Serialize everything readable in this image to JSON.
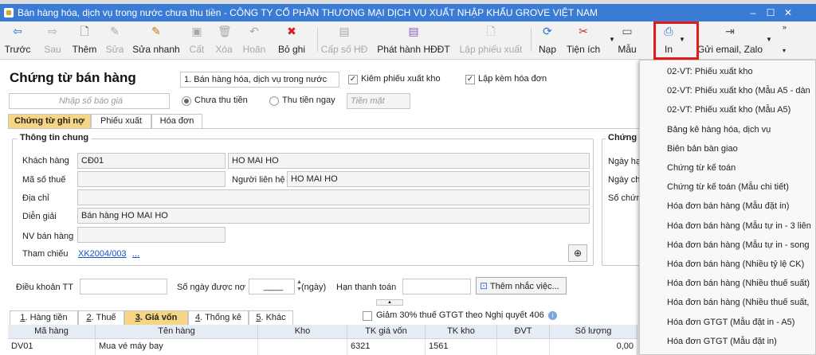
{
  "window": {
    "title": "Bán hàng hóa, dịch vụ trong nước chưa thu tiền - CÔNG TY CỔ PHẦN THƯƠNG MẠI DỊCH VỤ XUẤT NHẬP KHẨU GROVE VIỆT NAM",
    "minimize": "–",
    "maximize": "☐",
    "close": "✕"
  },
  "toolbar": [
    {
      "label": "Trước",
      "icon": "arrow-left-icon",
      "glyph": "⇦",
      "enabled": true,
      "color": "#2b6fd6"
    },
    {
      "label": "Sau",
      "icon": "arrow-right-icon",
      "glyph": "⇨",
      "enabled": false,
      "color": "#a8a8a8"
    },
    {
      "label": "Thêm",
      "icon": "add-document-icon",
      "glyph": "🗋",
      "enabled": true,
      "color": "#555"
    },
    {
      "label": "Sửa",
      "icon": "edit-icon",
      "glyph": "✎",
      "enabled": false,
      "color": "#a8a8a8"
    },
    {
      "label": "Sửa nhanh",
      "icon": "quick-edit-icon",
      "glyph": "✎",
      "enabled": true,
      "color": "#c07a10"
    },
    {
      "label": "Cất",
      "icon": "save-icon",
      "glyph": "▣",
      "enabled": false,
      "color": "#a8a8a8"
    },
    {
      "label": "Xóa",
      "icon": "delete-icon",
      "glyph": "🗑",
      "enabled": false,
      "color": "#a8a8a8"
    },
    {
      "label": "Hoãn",
      "icon": "undo-icon",
      "glyph": "↶",
      "enabled": false,
      "color": "#a8a8a8"
    },
    {
      "label": "Bỏ ghi",
      "icon": "unpost-icon",
      "glyph": "✖",
      "enabled": true,
      "color": "#d62020"
    },
    {
      "label": "Cấp số HĐ",
      "icon": "invoice-number-icon",
      "glyph": "▤",
      "enabled": false,
      "color": "#a8a8a8"
    },
    {
      "label": "Phát hành HĐĐT",
      "icon": "issue-einvoice-icon",
      "glyph": "▤",
      "enabled": true,
      "color": "#8a5cc8"
    },
    {
      "label": "Lập phiếu xuất",
      "icon": "create-slip-icon",
      "glyph": "🗋",
      "enabled": false,
      "color": "#a8a8a8"
    },
    {
      "label": "Nạp",
      "icon": "refresh-icon",
      "glyph": "⟳",
      "enabled": true,
      "color": "#2b6fd6"
    },
    {
      "label": "Tiện ích",
      "icon": "tools-icon",
      "glyph": "✂",
      "enabled": true,
      "color": "#c03030"
    },
    {
      "label": "Mẫu",
      "icon": "template-icon",
      "glyph": "▭",
      "enabled": true,
      "color": "#555"
    },
    {
      "label": "In",
      "icon": "printer-icon",
      "glyph": "⎙",
      "enabled": true,
      "color": "#2b6fd6"
    },
    {
      "label": "Gửi email, Zalo",
      "icon": "send-icon",
      "glyph": "⇥",
      "enabled": true,
      "color": "#555"
    }
  ],
  "form": {
    "heading": "Chứng từ bán hàng",
    "sale_type": "1. Bán hàng hóa, dịch vụ trong nước",
    "chk_export": "Kiêm phiếu xuất kho",
    "chk_invoice": "Lập kèm hóa đơn",
    "quote_placeholder": "Nhập số báo giá",
    "radio_unpaid": "Chưa thu tiền",
    "radio_paid": "Thu tiền ngay",
    "pay_method": "Tiền mặt",
    "tabs": [
      "Chứng từ ghi nợ",
      "Phiếu xuất",
      "Hóa đơn"
    ],
    "general_title": "Thông tin chung",
    "doc_title": "Chứng t",
    "lbl_customer": "Khách hàng",
    "customer_code": "CĐ01",
    "customer_name": "HO MAI HO",
    "lbl_tax": "Mã số thuế",
    "lbl_contact": "Người liên hệ",
    "contact": "HO MAI HO",
    "lbl_address": "Địa chỉ",
    "lbl_desc": "Diễn giải",
    "desc": "Bán hàng HO MAI HO",
    "lbl_staff": "NV bán hàng",
    "lbl_ref": "Tham chiếu",
    "ref": "XK2004/003",
    "ref_more": "...",
    "doc_labels": [
      "Ngày hạ",
      "Ngày ch",
      "Số chứn"
    ],
    "lbl_terms": "Điều khoản TT",
    "lbl_days": "Số ngày được nợ",
    "days_value": "____",
    "days_unit": "(ngày)",
    "lbl_due": "Hạn thanh toán",
    "reminder_btn": "Thêm nhắc việc...",
    "vat_reduce": "Giảm 30% thuế GTGT theo Nghị quyết 406"
  },
  "detail_tabs": [
    {
      "key": "1",
      "rest": ". Hàng tiền",
      "active": false
    },
    {
      "key": "2",
      "rest": ". Thuế",
      "active": false
    },
    {
      "key": "3",
      "rest": ". Giá vốn",
      "active": true
    },
    {
      "key": "4",
      "rest": ". Thống kê",
      "active": false
    },
    {
      "key": "5",
      "rest": ". Khác",
      "active": false
    }
  ],
  "grid": {
    "headers": [
      "Mã hàng",
      "Tên hàng",
      "Kho",
      "TK giá vốn",
      "TK kho",
      "ĐVT",
      "Số lượng"
    ],
    "row": [
      "DV01",
      "Mua vé máy bay",
      "",
      "6321",
      "1561",
      "",
      "0,00"
    ]
  },
  "print_menu": [
    "02-VT: Phiếu xuất kho",
    "02-VT: Phiếu xuất kho (Mẫu A5 - dàn",
    "02-VT: Phiếu xuất kho (Mẫu A5)",
    "Bảng kê hàng hóa, dịch vụ",
    "Biên bản bàn giao",
    "Chứng từ kế toán",
    "Chứng từ kế toán (Mẫu chi tiết)",
    "Hóa đơn bán hàng (Mẫu đặt in)",
    "Hóa đơn bán hàng (Mẫu tự in - 3 liên",
    "Hóa đơn bán hàng (Mẫu tự in - song",
    "Hóa đơn bán hàng (Nhiều tỷ lệ CK)",
    "Hóa đơn bán hàng (Nhiều thuế suất)",
    "Hóa đơn bán hàng (Nhiều thuế suất,",
    "Hóa đơn GTGT (Mẫu đặt in - A5)",
    "Hóa đơn GTGT (Mẫu đặt in)"
  ]
}
